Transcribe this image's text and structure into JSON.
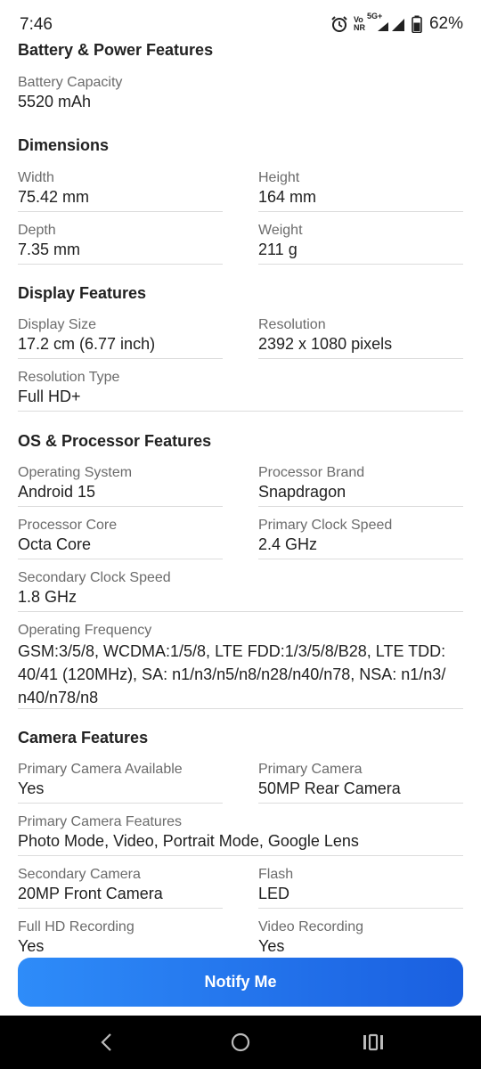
{
  "status_bar": {
    "time": "7:46",
    "network_top": "Vo",
    "network_bottom": "NR",
    "network_type": "5G+",
    "battery": "62%",
    "icons": [
      "alarm-icon",
      "signal-icon",
      "battery-icon"
    ]
  },
  "sections": {
    "battery": {
      "title": "Battery & Power Features",
      "capacity_label": "Battery Capacity",
      "capacity_value": "5520 mAh"
    },
    "dimensions": {
      "title": "Dimensions",
      "width_label": "Width",
      "width_value": "75.42 mm",
      "height_label": "Height",
      "height_value": "164 mm",
      "depth_label": "Depth",
      "depth_value": "7.35 mm",
      "weight_label": "Weight",
      "weight_value": "211 g"
    },
    "display": {
      "title": "Display Features",
      "size_label": "Display Size",
      "size_value": "17.2 cm (6.77 inch)",
      "resolution_label": "Resolution",
      "resolution_value": "2392 x 1080 pixels",
      "res_type_label": "Resolution Type",
      "res_type_value": "Full HD+"
    },
    "os": {
      "title": "OS & Processor Features",
      "os_label": "Operating System",
      "os_value": "Android 15",
      "brand_label": "Processor Brand",
      "brand_value": "Snapdragon",
      "core_label": "Processor Core",
      "core_value": "Octa Core",
      "primary_clock_label": "Primary Clock Speed",
      "primary_clock_value": "2.4 GHz",
      "secondary_clock_label": "Secondary Clock Speed",
      "secondary_clock_value": "1.8 GHz",
      "freq_label": "Operating Frequency",
      "freq_line1": "GSM:3/5/8, WCDMA:1/5/8, LTE FDD:1/3/5/8/B28, LTE TDD:",
      "freq_line2": "40/41 (120MHz), SA: n1/n3/n5/n8/n28/n40/n78, NSA: n1/n3/",
      "freq_line3": "n40/n78/n8"
    },
    "camera": {
      "title": "Camera Features",
      "primary_available_label": "Primary Camera Available",
      "primary_available_value": "Yes",
      "primary_label": "Primary Camera",
      "primary_value": "50MP Rear Camera",
      "primary_features_label": "Primary Camera Features",
      "primary_features_value": "Photo Mode, Video, Portrait Mode, Google Lens",
      "secondary_label": "Secondary Camera",
      "secondary_value": "20MP Front Camera",
      "flash_label": "Flash",
      "flash_value": "LED",
      "fullhd_label": "Full HD Recording",
      "fullhd_value": "Yes",
      "video_label": "Video Recording",
      "video_value": "Yes"
    }
  },
  "notify_button": {
    "label": "Notify Me"
  },
  "nav_bar": {
    "icons": [
      "back-icon",
      "home-icon",
      "recents-icon"
    ]
  }
}
